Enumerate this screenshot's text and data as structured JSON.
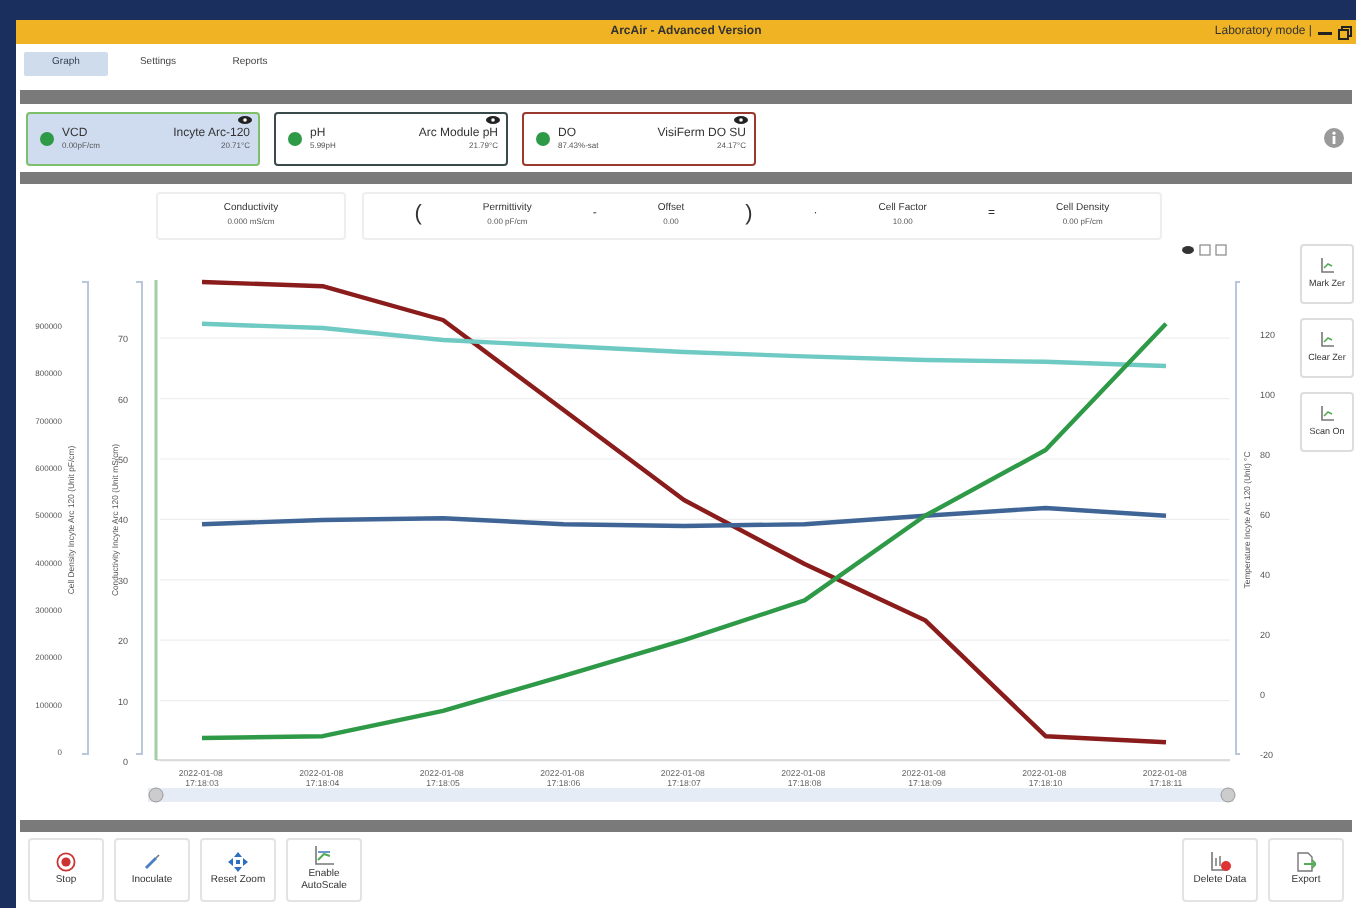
{
  "window": {
    "title": "ArcAir - Advanced Version",
    "mode": "Laboratory mode |"
  },
  "tabs": [
    {
      "label": "Graph",
      "selected": true
    },
    {
      "label": "Settings",
      "selected": false
    },
    {
      "label": "Reports",
      "selected": false
    }
  ],
  "sensors": [
    {
      "name": "VCD",
      "value": "0.00pF/cm",
      "device": "Incyte Arc-120",
      "temperature": "20.71°C",
      "selected": true,
      "color": "#7dbf6a"
    },
    {
      "name": "pH",
      "value": "5.99pH",
      "device": "Arc Module pH",
      "temperature": "21.79°C",
      "selected": false,
      "color": "#3a4a4a"
    },
    {
      "name": "DO",
      "value": "87.43%-sat",
      "device": "VisiFerm DO SU",
      "temperature": "24.17°C",
      "selected": false,
      "color": "#9a3a2e"
    }
  ],
  "formula": {
    "first": {
      "label": "Conductivity",
      "value": "0.000 mS/cm"
    },
    "terms": [
      {
        "kind": "symbol",
        "text": "("
      },
      {
        "kind": "term",
        "label": "Permittivity",
        "value": "0.00 pF/cm"
      },
      {
        "kind": "operator",
        "text": "-"
      },
      {
        "kind": "term",
        "label": "Offset",
        "value": "0.00"
      },
      {
        "kind": "symbol",
        "text": ")"
      },
      {
        "kind": "operator",
        "text": "·"
      },
      {
        "kind": "term",
        "label": "Cell Factor",
        "value": "10.00"
      },
      {
        "kind": "operator",
        "text": "="
      },
      {
        "kind": "term",
        "label": "Cell Density",
        "value": "0.00 pF/cm"
      }
    ]
  },
  "graph": {
    "cell_density_axis": {
      "title": "Cell Density Incyte Arc 120 (Unit pF/cm)",
      "ticks": [
        "900000",
        "800000",
        "700000",
        "600000",
        "500000",
        "400000",
        "300000",
        "200000",
        "100000",
        "0"
      ]
    },
    "temperature_axis": {
      "title": "Temperature Incyte Arc 120 (Unit) °C",
      "ticks": [
        "120",
        "100",
        "80",
        "60",
        "40",
        "20",
        "0",
        "-20"
      ]
    },
    "chart_data": {
      "type": "line",
      "ylabel": "Conductivity Incyte Arc 120 (Unit mS/cm)",
      "grid": true,
      "categories": [
        "2022-01-08 17:18:03",
        "2022-01-08 17:18:04",
        "2022-01-08 17:18:05",
        "2022-01-08 17:18:06",
        "2022-01-08 17:18:07",
        "2022-01-08 17:18:08",
        "2022-01-08 17:18:09",
        "2022-01-08 17:18:10",
        "2022-01-08 17:18:11"
      ],
      "ylim": [
        0,
        80
      ],
      "yticks": [
        {
          "value": 70,
          "label": "70"
        },
        {
          "value": 60,
          "label": "60"
        },
        {
          "value": 50,
          "label": "50"
        },
        {
          "value": 40,
          "label": "40"
        },
        {
          "value": 30,
          "label": "30"
        },
        {
          "value": 20,
          "label": "20"
        },
        {
          "value": 10,
          "label": "10"
        },
        {
          "value": 0,
          "label": "0"
        }
      ],
      "series": [
        {
          "color": "#8b1c1c",
          "values": [
            79.3,
            78.6,
            73.0,
            58.1,
            43.2,
            32.6,
            23.3,
            4.1,
            3.1
          ]
        },
        {
          "color": "#6fcac4",
          "values": [
            72.4,
            71.7,
            69.7,
            68.7,
            67.7,
            67.0,
            66.4,
            66.1,
            65.4
          ]
        },
        {
          "color": "#3f6496",
          "values": [
            39.2,
            39.9,
            40.2,
            39.2,
            38.9,
            39.2,
            40.6,
            41.9,
            40.6
          ]
        },
        {
          "color": "#2e9a47",
          "values": [
            3.8,
            4.1,
            8.3,
            14.1,
            20.0,
            26.6,
            40.6,
            51.5,
            72.4
          ]
        }
      ]
    }
  },
  "side_buttons": [
    "Mark Zer",
    "Clear Zer",
    "Scan On"
  ],
  "toolbar": [
    {
      "kind": "stop",
      "label": "Stop"
    },
    {
      "kind": "inoculate",
      "label": "Inoculate"
    },
    {
      "kind": "reset",
      "label": "Reset Zoom"
    },
    {
      "kind": "autoscale",
      "label": "Enable AutoScale"
    }
  ],
  "toolbar_right": [
    {
      "kind": "delete",
      "label": "Delete Data"
    },
    {
      "kind": "export",
      "label": "Export"
    }
  ]
}
